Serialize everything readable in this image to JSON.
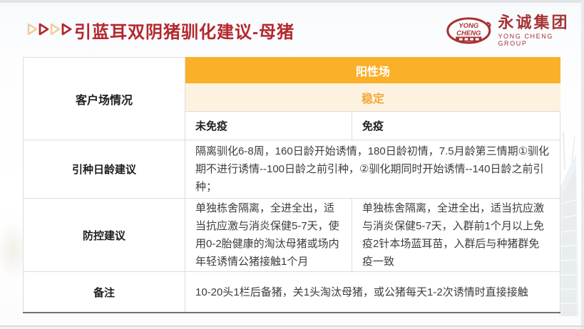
{
  "header": {
    "title": "引蓝耳双阴猪驯化建议-母猪",
    "logo": {
      "badge_line1": "YONG",
      "badge_line2": "CHENG",
      "company_cn": "永诚集团",
      "company_en": "YONG CHENG GROUP"
    }
  },
  "table": {
    "corner_label": "客户场情况",
    "farm_status_header": "阳性场",
    "stability_subheader": "稳定",
    "col_unvaccinated": "未免疫",
    "col_vaccinated": "免疫",
    "rows": {
      "intro_age": {
        "label": "引种日龄建议",
        "content": "隔离驯化6-8周，160日龄开始诱情，180日龄初情，7.5月龄第三情期①驯化期不进行诱情--100日龄之前引种，②驯化期同时开始诱情--140日龄之前引种；"
      },
      "prevention": {
        "label": "防控建议",
        "unvaccinated": "单独栋舍隔离，全进全出，适当抗应激与消炎保健5-7天，使用0-2胎健康的淘汰母猪或场内年轻诱情公猪接触1个月",
        "vaccinated": "单独栋舍隔离，全进全出，适当抗应激与消炎保健5-7天，入群前1个月以上免疫2针本场蓝耳苗，入群后与种猪群免疫一致"
      },
      "notes": {
        "label": "备注",
        "content": "10-20头1栏后备猪，关1头淘汰母猪，或公猪每天1-2次诱情时直接接触"
      }
    }
  },
  "colors": {
    "title_red": "#b3282d",
    "logo_red": "#a63134",
    "header_orange": "#fbb02a",
    "subheader_cream": "#fdf2df",
    "subheader_text_orange": "#f2a93b",
    "table_border": "#dcdcdc",
    "table_bottom_border": "#707070",
    "body_text": "#3d3d3d"
  }
}
